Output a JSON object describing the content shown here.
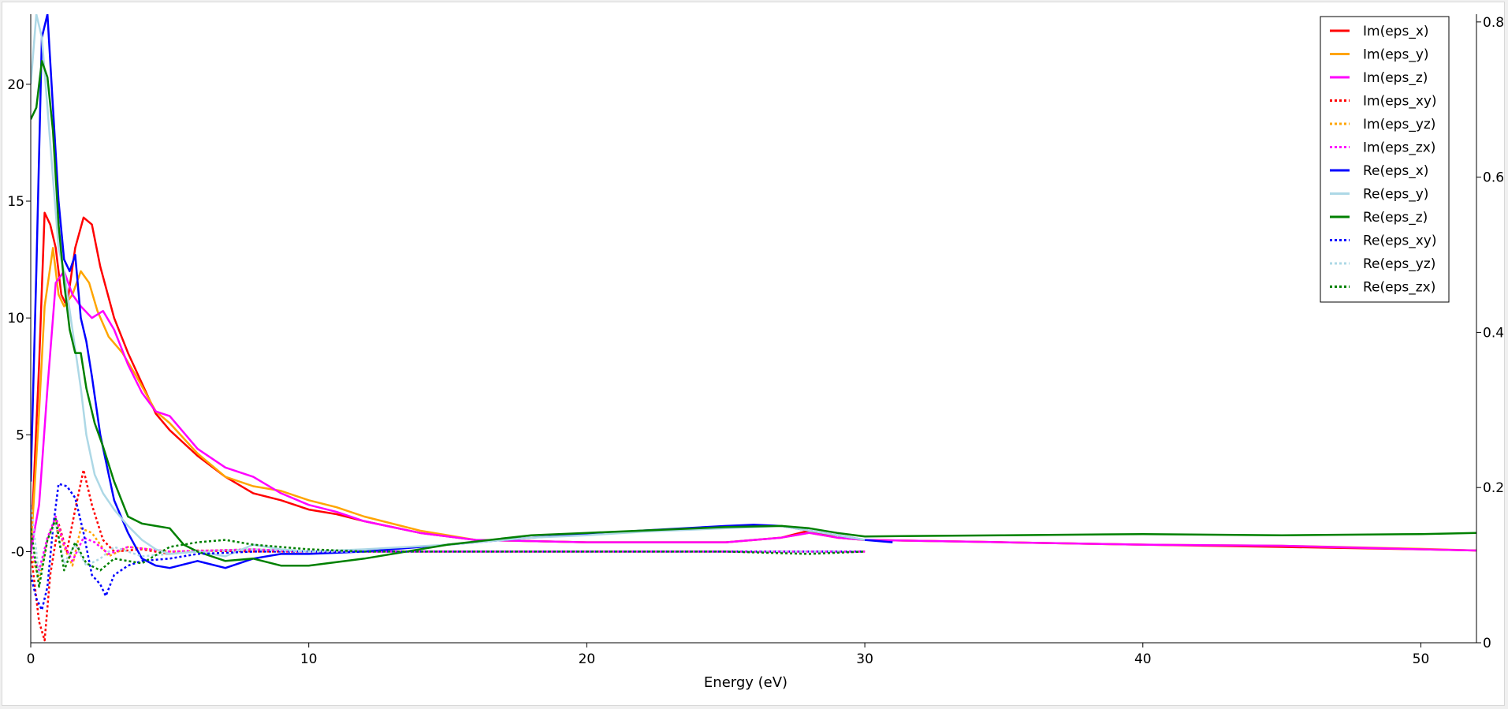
{
  "chart_data": {
    "type": "line",
    "xlabel": "Energy (eV)",
    "ylabel": "",
    "xlim": [
      0,
      52
    ],
    "ylim": [
      -3.9,
      23
    ],
    "y2lim": [
      0,
      0.81
    ],
    "xticks": [
      "0",
      "10",
      "20",
      "30",
      "40",
      "50"
    ],
    "yticks": [
      "-0",
      "5",
      "10",
      "15",
      "20"
    ],
    "y2ticks": [
      "0",
      "0.2",
      "0.4",
      "0.6",
      "0.8"
    ],
    "grid": false,
    "legend_position": "top-right",
    "series": [
      {
        "name": "Im(eps_x)",
        "color": "#ff0000",
        "style": "solid",
        "x": [
          0,
          0.3,
          0.5,
          0.7,
          0.9,
          1.1,
          1.3,
          1.6,
          1.9,
          2.2,
          2.5,
          3,
          3.5,
          4,
          4.5,
          5,
          6,
          7,
          8,
          9,
          10,
          11,
          12,
          14,
          16,
          20,
          25,
          27,
          28,
          29,
          30,
          35,
          40,
          45,
          50,
          52
        ],
        "y": [
          0,
          8,
          14.5,
          14,
          13,
          11,
          10.5,
          13,
          14.3,
          14,
          12.2,
          10,
          8.5,
          7.2,
          5.9,
          5.2,
          4.1,
          3.2,
          2.5,
          2.2,
          1.8,
          1.6,
          1.3,
          0.8,
          0.5,
          0.4,
          0.4,
          0.6,
          0.9,
          0.6,
          0.5,
          0.4,
          0.3,
          0.2,
          0.1,
          0.05
        ]
      },
      {
        "name": "Im(eps_y)",
        "color": "#ffa500",
        "style": "solid",
        "x": [
          0,
          0.3,
          0.5,
          0.8,
          1,
          1.2,
          1.5,
          1.8,
          2.1,
          2.4,
          2.8,
          3.3,
          3.8,
          4.5,
          5,
          6,
          7,
          8,
          9,
          10,
          11,
          12,
          14,
          16,
          20,
          25,
          27,
          28,
          29,
          30,
          35,
          40,
          45,
          50,
          52
        ],
        "y": [
          0,
          6,
          10.5,
          13,
          11,
          10.5,
          11,
          12,
          11.5,
          10.3,
          9.2,
          8.5,
          7.5,
          6,
          5.5,
          4.2,
          3.2,
          2.8,
          2.6,
          2.2,
          1.9,
          1.5,
          0.9,
          0.5,
          0.4,
          0.4,
          0.6,
          0.8,
          0.6,
          0.5,
          0.4,
          0.3,
          0.25,
          0.12,
          0.05
        ]
      },
      {
        "name": "Im(eps_z)",
        "color": "#ff00ff",
        "style": "solid",
        "x": [
          0,
          0.3,
          0.6,
          0.9,
          1.2,
          1.5,
          1.8,
          2.2,
          2.6,
          3,
          3.5,
          4,
          4.5,
          5,
          6,
          7,
          8,
          9,
          10,
          11,
          12,
          14,
          16,
          20,
          25,
          27,
          28,
          29,
          30,
          35,
          40,
          45,
          50,
          52
        ],
        "y": [
          0,
          2,
          7,
          11.5,
          12,
          11,
          10.5,
          10,
          10.3,
          9.5,
          8,
          6.8,
          6,
          5.8,
          4.4,
          3.6,
          3.2,
          2.5,
          2,
          1.7,
          1.3,
          0.8,
          0.5,
          0.4,
          0.4,
          0.6,
          0.8,
          0.6,
          0.5,
          0.4,
          0.3,
          0.25,
          0.1,
          0.05
        ]
      },
      {
        "name": "Im(eps_xy)",
        "color": "#ff0000",
        "style": "dotted",
        "x": [
          0,
          0.3,
          0.5,
          0.7,
          1,
          1.3,
          1.6,
          1.9,
          2.2,
          2.6,
          3,
          4,
          5,
          6,
          8,
          10,
          15,
          20,
          25,
          28,
          30
        ],
        "y": [
          0,
          -3,
          -3.8,
          -1,
          1.2,
          0,
          1.8,
          3.5,
          2,
          0.5,
          0,
          0.1,
          -0.1,
          0.05,
          0,
          0,
          0,
          0,
          0,
          0,
          0
        ]
      },
      {
        "name": "Im(eps_yz)",
        "color": "#ffa500",
        "style": "dotted",
        "x": [
          0,
          0.3,
          0.6,
          0.9,
          1.2,
          1.5,
          1.8,
          2.2,
          2.8,
          3.5,
          5,
          8,
          10,
          15,
          20,
          25,
          28,
          30
        ],
        "y": [
          0,
          -1.2,
          0.5,
          1.4,
          0.2,
          -0.6,
          1,
          0.8,
          -0.2,
          0.2,
          0,
          0.1,
          0,
          0,
          0,
          0,
          0,
          0
        ]
      },
      {
        "name": "Im(eps_zx)",
        "color": "#ff00ff",
        "style": "dotted",
        "x": [
          0,
          0.3,
          0.6,
          0.9,
          1.2,
          1.5,
          1.9,
          2.3,
          2.8,
          3.5,
          5,
          8,
          10,
          15,
          20,
          25,
          28,
          30
        ],
        "y": [
          0,
          -0.8,
          0.6,
          1.5,
          0.3,
          -0.4,
          0.6,
          0.4,
          -0.1,
          0.2,
          0,
          0.1,
          0,
          0,
          0,
          0,
          0,
          0
        ]
      },
      {
        "name": "Re(eps_x)",
        "color": "#0000ff",
        "style": "solid",
        "x": [
          0,
          0.2,
          0.4,
          0.6,
          0.8,
          1,
          1.2,
          1.4,
          1.6,
          1.8,
          2,
          2.2,
          2.5,
          3,
          3.5,
          4,
          4.5,
          5,
          6,
          7,
          8,
          9,
          10,
          12,
          15,
          18,
          20,
          22,
          25,
          26,
          27,
          28,
          29,
          30,
          31
        ],
        "y": [
          3,
          12,
          22,
          23,
          19,
          15,
          12.5,
          12,
          12.7,
          10,
          9,
          7.5,
          5,
          2.2,
          0.8,
          -0.3,
          -0.6,
          -0.7,
          -0.4,
          -0.7,
          -0.3,
          -0.1,
          -0.1,
          0,
          0.3,
          0.6,
          0.75,
          0.9,
          1.1,
          1.15,
          1.1,
          0.9,
          0.7,
          0.5,
          0.4
        ]
      },
      {
        "name": "Re(eps_y)",
        "color": "#add8e6",
        "style": "solid",
        "x": [
          0,
          0.2,
          0.4,
          0.6,
          0.8,
          1,
          1.2,
          1.5,
          1.8,
          2,
          2.3,
          2.6,
          3,
          3.5,
          4,
          4.5,
          5,
          6,
          7,
          8,
          9,
          10,
          12,
          15,
          18,
          20,
          22,
          25,
          27,
          28,
          29,
          30
        ],
        "y": [
          20,
          23,
          22,
          19,
          16,
          13,
          12,
          9.5,
          7,
          5,
          3.3,
          2.5,
          1.8,
          1.1,
          0.5,
          0.1,
          -0.1,
          0,
          -0.2,
          0.3,
          0.1,
          0,
          0.1,
          0.3,
          0.6,
          0.7,
          0.85,
          1,
          1.1,
          0.9,
          0.7,
          0.5
        ]
      },
      {
        "name": "Re(eps_z)",
        "color": "#008000",
        "style": "solid",
        "x": [
          0,
          0.2,
          0.4,
          0.6,
          0.8,
          1,
          1.2,
          1.4,
          1.6,
          1.8,
          2,
          2.3,
          2.6,
          3,
          3.5,
          4,
          4.5,
          5,
          5.5,
          6,
          7,
          8,
          9,
          10,
          12,
          15,
          18,
          20,
          22,
          25,
          27,
          28,
          29,
          30,
          35,
          40,
          45,
          50,
          52
        ],
        "y": [
          18.5,
          19,
          21,
          20.3,
          18,
          14,
          11.5,
          9.5,
          8.5,
          8.5,
          7,
          5.5,
          4.5,
          3,
          1.5,
          1.2,
          1.1,
          1,
          0.3,
          0,
          -0.4,
          -0.3,
          -0.6,
          -0.6,
          -0.3,
          0.3,
          0.7,
          0.8,
          0.9,
          1.05,
          1.1,
          1,
          0.8,
          0.65,
          0.7,
          0.75,
          0.7,
          0.75,
          0.8
        ]
      },
      {
        "name": "Re(eps_xy)",
        "color": "#0000ff",
        "style": "dotted",
        "x": [
          0,
          0.2,
          0.4,
          0.6,
          0.8,
          1,
          1.3,
          1.6,
          1.9,
          2.2,
          2.5,
          2.7,
          3,
          3.5,
          4,
          5,
          6,
          8,
          10,
          15,
          20,
          25,
          30
        ],
        "y": [
          -1,
          -2,
          -2.5,
          -1.5,
          1,
          2.9,
          2.8,
          2.3,
          0.8,
          -1,
          -1.4,
          -1.9,
          -1,
          -0.6,
          -0.4,
          -0.3,
          -0.1,
          0,
          0,
          0,
          0,
          0,
          0
        ]
      },
      {
        "name": "Re(eps_yz)",
        "color": "#add8e6",
        "style": "dotted",
        "x": [
          0,
          0.3,
          0.6,
          0.9,
          1.2,
          1.6,
          2,
          2.5,
          3,
          4,
          5,
          6,
          8,
          10,
          15,
          20,
          25,
          30
        ],
        "y": [
          2,
          -1,
          0.5,
          1.2,
          -0.5,
          0.3,
          -0.6,
          -0.3,
          0.2,
          -0.2,
          -0.1,
          0,
          0.1,
          0,
          0,
          0,
          0,
          0
        ]
      },
      {
        "name": "Re(eps_zx)",
        "color": "#008000",
        "style": "dotted",
        "x": [
          0,
          0.3,
          0.6,
          0.9,
          1.2,
          1.6,
          2,
          2.5,
          3,
          4,
          5,
          6,
          7,
          8,
          9,
          10,
          12,
          15,
          20,
          25,
          28,
          30
        ],
        "y": [
          1,
          -1.5,
          0.5,
          1.4,
          -0.8,
          0.4,
          -0.5,
          -0.8,
          -0.3,
          -0.5,
          0.2,
          0.4,
          0.5,
          0.3,
          0.2,
          0.1,
          0,
          0,
          0,
          0,
          -0.1,
          0
        ]
      }
    ]
  }
}
